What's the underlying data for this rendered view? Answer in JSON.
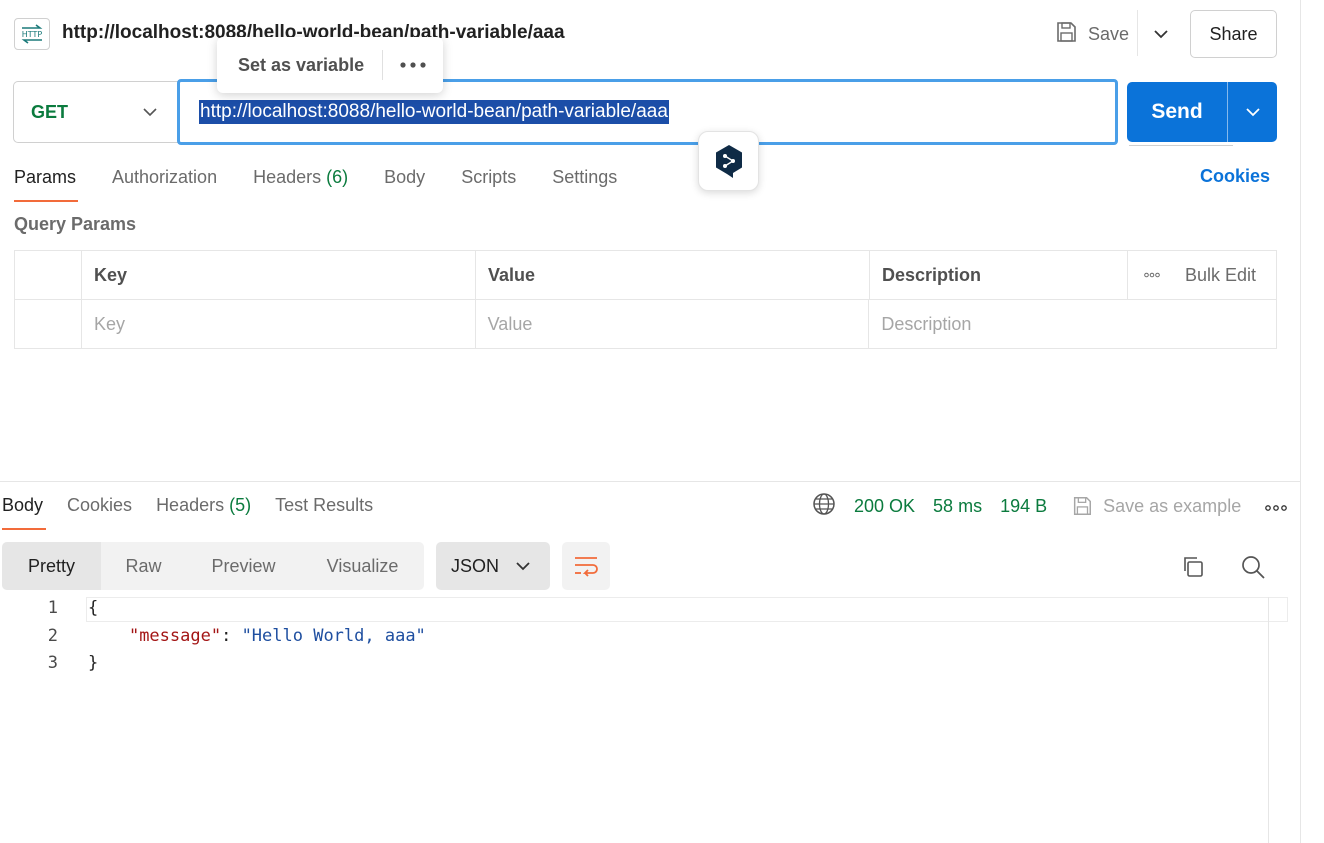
{
  "request": {
    "title": "http://localhost:8088/hello-world-bean/path-variable/aaa",
    "icon_label": "HTTP",
    "save_label": "Save",
    "share_label": "Share",
    "method": "GET",
    "url": "http://localhost:8088/hello-world-bean/path-variable/aaa",
    "send_label": "Send",
    "popover": {
      "label": "Set as variable"
    },
    "tabs": [
      {
        "label": "Params"
      },
      {
        "label": "Authorization"
      },
      {
        "label": "Headers",
        "count": "(6)"
      },
      {
        "label": "Body"
      },
      {
        "label": "Scripts"
      },
      {
        "label": "Settings"
      }
    ],
    "cookies_label": "Cookies",
    "query_params_label": "Query Params",
    "params_table": {
      "headers": {
        "key": "Key",
        "value": "Value",
        "description": "Description",
        "bulk_edit": "Bulk Edit"
      },
      "placeholders": {
        "key": "Key",
        "value": "Value",
        "description": "Description"
      }
    }
  },
  "response": {
    "tabs": [
      {
        "label": "Body"
      },
      {
        "label": "Cookies"
      },
      {
        "label": "Headers",
        "count": "(5)"
      },
      {
        "label": "Test Results"
      }
    ],
    "status": "200 OK",
    "time": "58 ms",
    "size": "194 B",
    "save_example_label": "Save as example",
    "views": [
      "Pretty",
      "Raw",
      "Preview",
      "Visualize"
    ],
    "format": "JSON",
    "code_lines": [
      {
        "num": "1",
        "text": "{"
      },
      {
        "num": "2",
        "key": "\"message\"",
        "sep": ": ",
        "value": "\"Hello World, aaa\""
      },
      {
        "num": "3",
        "text": "}"
      }
    ]
  },
  "colors": {
    "accent": "#0b73d9",
    "method_get": "#0b7b3e",
    "active_tab_underline": "#f26b3a",
    "selection": "#1c4ea8"
  }
}
